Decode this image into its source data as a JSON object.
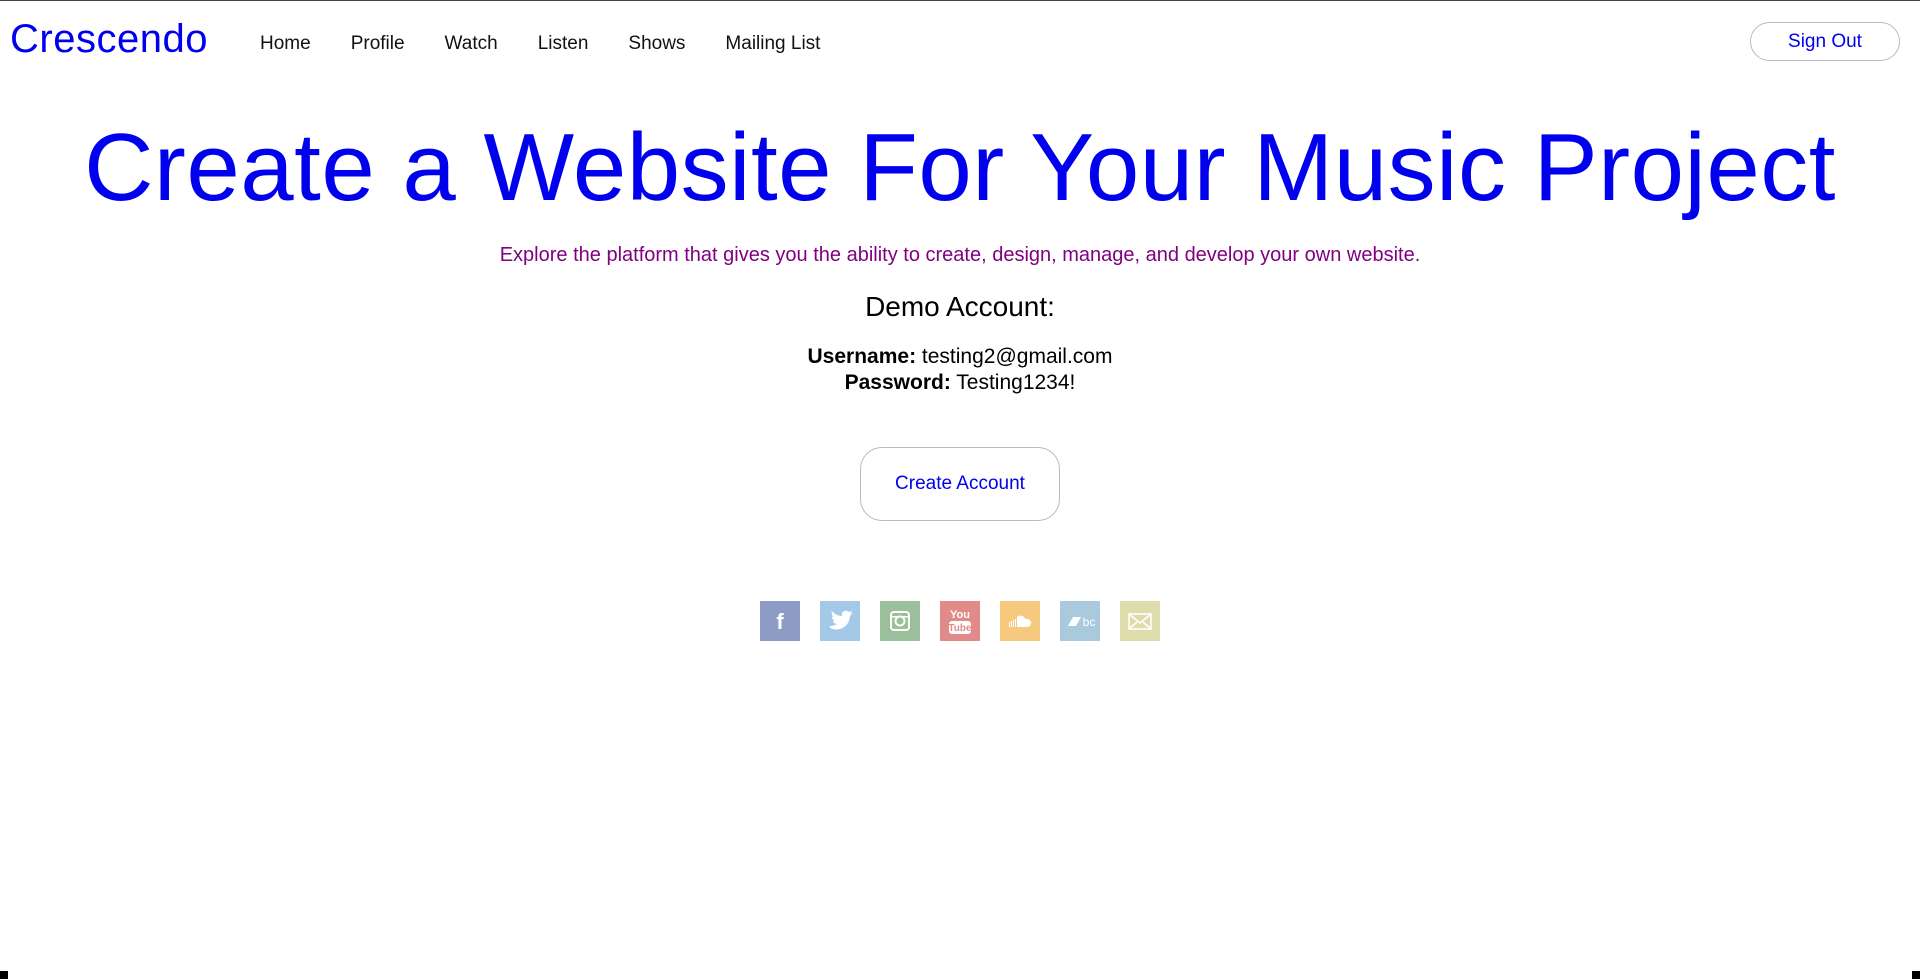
{
  "nav": {
    "brand": "Crescendo",
    "links": [
      "Home",
      "Profile",
      "Watch",
      "Listen",
      "Shows",
      "Mailing List"
    ],
    "signout_label": "Sign Out"
  },
  "hero": {
    "title": "Create a Website For Your Music Project",
    "subtitle": "Explore the platform that gives you the ability to create, design, manage, and develop your own website."
  },
  "demo": {
    "heading": "Demo Account:",
    "username_label": "Username:",
    "username_value": "testing2@gmail.com",
    "password_label": "Password:",
    "password_value": "Testing1234!"
  },
  "cta": {
    "create_account_label": "Create Account"
  },
  "socials": [
    {
      "name": "facebook-icon",
      "color": "#8c9cc4",
      "glyph": "f"
    },
    {
      "name": "twitter-icon",
      "color": "#a3c8e8"
    },
    {
      "name": "instagram-icon",
      "color": "#9bbf9b"
    },
    {
      "name": "youtube-icon",
      "color": "#e08a8a",
      "glyph": "You Tube"
    },
    {
      "name": "soundcloud-icon",
      "color": "#f6c97e"
    },
    {
      "name": "bandcamp-icon",
      "color": "#a9c9dc",
      "glyph": "bc"
    },
    {
      "name": "email-icon",
      "color": "#dedcaa"
    }
  ],
  "colors": {
    "brand": "#0000ee",
    "subtitle": "#800080"
  }
}
